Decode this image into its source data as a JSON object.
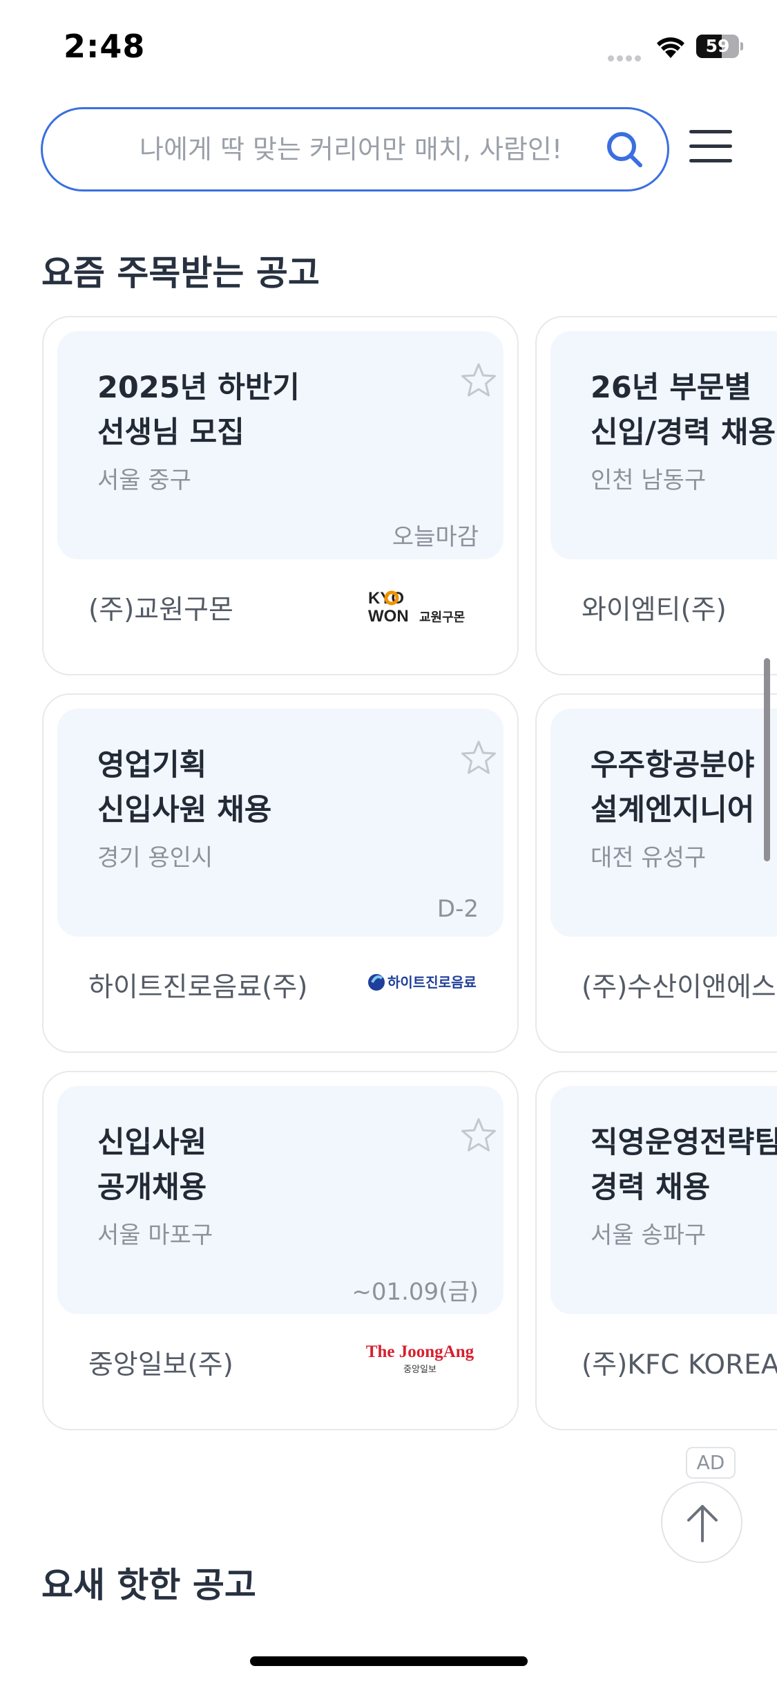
{
  "status_bar": {
    "time": "2:48",
    "battery": "59",
    "battery_level": 0.59
  },
  "search": {
    "placeholder": "나에게 딱 맞는 커리어만 매치, 사람인!"
  },
  "sections": {
    "trending_title": "요즘 주목받는 공고",
    "hot_title": "요새 핫한 공고"
  },
  "jobs": [
    {
      "title_line1": "2025년 하반기",
      "title_line2": "선생님 모집",
      "location": "서울 중구",
      "deadline": "오늘마감",
      "company": "(주)교원구몬",
      "logo": "kyowon-logo",
      "logo_text_a": "KYO",
      "logo_text_b": "WON",
      "logo_text_c": "교원구몬"
    },
    {
      "title_line1": "26년 부문별",
      "title_line2": "신입/경력 채용",
      "location": "인천 남동구",
      "deadline": "",
      "company": "와이엠티(주)"
    },
    {
      "title_line1": "영업기획",
      "title_line2": "신입사원 채용",
      "location": "경기 용인시",
      "deadline": "D-2",
      "company": "하이트진로음료(주)",
      "logo": "hitejinro-logo",
      "logo_text": "하이트진로음료"
    },
    {
      "title_line1": "우주항공분야",
      "title_line2": "설계엔지니어",
      "location": "대전 유성구",
      "deadline": "",
      "company": "(주)수산이앤에스"
    },
    {
      "title_line1": "신입사원",
      "title_line2": "공개채용",
      "location": "서울 마포구",
      "deadline": "~01.09(금)",
      "company": "중앙일보(주)",
      "logo": "joongang-logo",
      "logo_text_a": "The JoongAng",
      "logo_text_b": "중앙일보"
    },
    {
      "title_line1": "직영운영전략팀",
      "title_line2": "경력 채용",
      "location": "서울 송파구",
      "deadline": "",
      "company": "(주)KFC KOREA"
    }
  ],
  "ad": {
    "label": "AD"
  },
  "icons": {
    "search": "search-icon",
    "menu": "hamburger-menu-icon",
    "star": "star-outline-icon",
    "top": "arrow-up-icon"
  },
  "colors": {
    "accent": "#3a6fe0",
    "card_bg": "#f2f6fd",
    "kyowon_orange": "#f39200",
    "joongang_red": "#d6202f",
    "hite_blue": "#1f3f9a"
  }
}
